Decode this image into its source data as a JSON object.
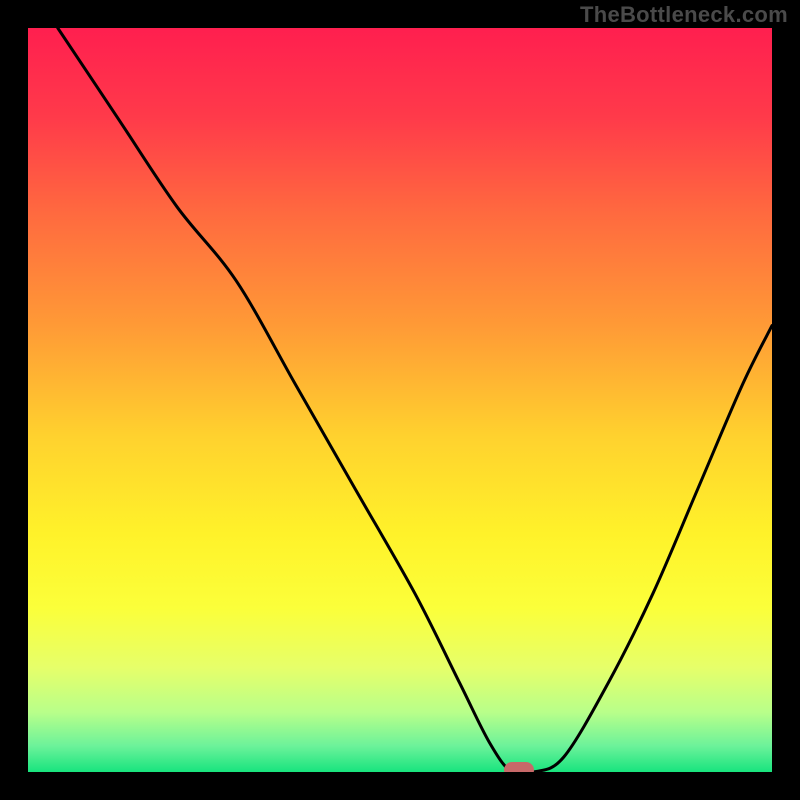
{
  "watermark": "TheBottleneck.com",
  "chart_data": {
    "type": "line",
    "title": "",
    "xlabel": "",
    "ylabel": "",
    "xlim": [
      0,
      100
    ],
    "ylim": [
      0,
      100
    ],
    "grid": false,
    "background": {
      "description": "vertical gradient, top to bottom",
      "stops": [
        {
          "pos": 0.0,
          "color": "#ff1f4f"
        },
        {
          "pos": 0.12,
          "color": "#ff3a4a"
        },
        {
          "pos": 0.25,
          "color": "#ff6a3f"
        },
        {
          "pos": 0.4,
          "color": "#ff9a36"
        },
        {
          "pos": 0.55,
          "color": "#ffd22e"
        },
        {
          "pos": 0.68,
          "color": "#fff22a"
        },
        {
          "pos": 0.78,
          "color": "#fbff3a"
        },
        {
          "pos": 0.86,
          "color": "#e6ff6a"
        },
        {
          "pos": 0.92,
          "color": "#b8ff8a"
        },
        {
          "pos": 0.965,
          "color": "#6cf29a"
        },
        {
          "pos": 1.0,
          "color": "#18e47e"
        }
      ]
    },
    "series": [
      {
        "name": "bottleneck-curve",
        "color": "#000000",
        "x": [
          4,
          12,
          20,
          28,
          36,
          44,
          52,
          58,
          62,
          65,
          68,
          72,
          78,
          84,
          90,
          96,
          100
        ],
        "y": [
          100,
          88,
          76,
          66,
          52,
          38,
          24,
          12,
          4,
          0,
          0,
          2,
          12,
          24,
          38,
          52,
          60
        ]
      }
    ],
    "marker": {
      "name": "optimum-marker",
      "x": 66,
      "y": 0,
      "color": "#c76969"
    },
    "annotations": []
  }
}
